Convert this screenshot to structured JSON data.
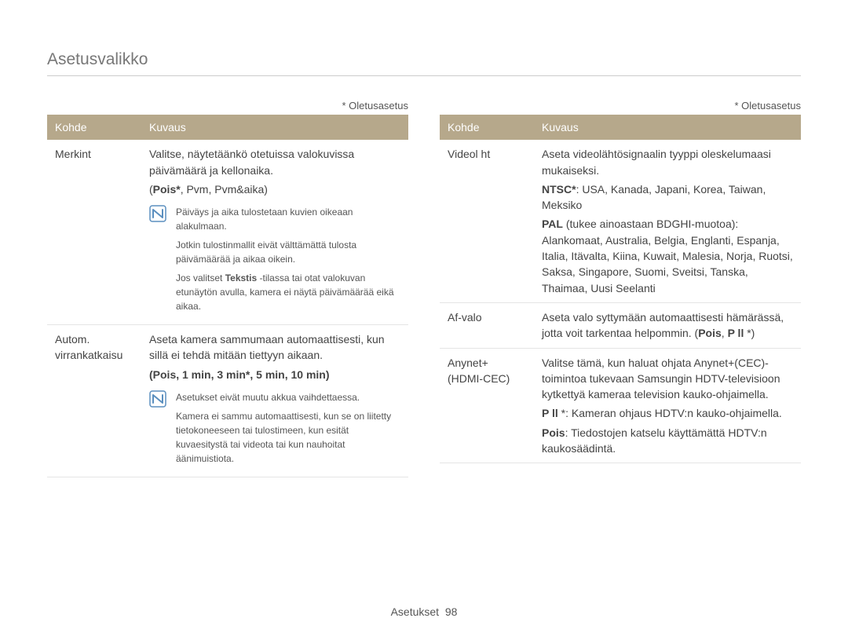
{
  "title": "Asetusvalikko",
  "default_label": "* Oletusasetus",
  "headers": {
    "kohde": "Kohde",
    "kuvaus": "Kuvaus"
  },
  "left": {
    "row1": {
      "kohde": "Merkint",
      "desc1": "Valitse, näytetäänkö otetuissa valokuvissa päivämäärä ja kellonaika.",
      "opts_prefix": "(",
      "opts_b": "Pois*",
      "opts_rest": ", Pvm, Pvm&aika)",
      "note1": "Päiväys ja aika tulostetaan kuvien oikeaan alakulmaan.",
      "note2": "Jotkin tulostinmallit eivät välttämättä tulosta päivämäärää ja aikaa oikein.",
      "note3_a": "Jos valitset ",
      "note3_b": "Tekstis",
      "note3_c": " -tilassa tai otat valokuvan etunäytön avulla, kamera ei näytä päivämäärää eikä aikaa."
    },
    "row2": {
      "kohde": "Autom. virrankatkaisu",
      "desc1": "Aseta kamera sammumaan automaattisesti, kun sillä ei tehdä mitään tiettyyn aikaan.",
      "opts": "(Pois, 1 min, 3 min*, 5 min, 10 min)",
      "note1": "Asetukset eivät muutu akkua vaihdettaessa.",
      "note2": "Kamera ei sammu automaattisesti, kun se on liitetty tietokoneeseen tai tulostimeen, kun esität kuvaesitystä tai videota tai kun nauhoitat äänimuistiota."
    }
  },
  "right": {
    "row1": {
      "kohde": "Videol ht",
      "desc1": "Aseta videolähtösignaalin tyyppi oleskelumaasi mukaiseksi.",
      "ntsc_b": "NTSC*",
      "ntsc_rest": ": USA, Kanada, Japani, Korea, Taiwan, Meksiko",
      "pal_b": "PAL",
      "pal_rest": " (tukee ainoastaan BDGHI-muotoa): Alankomaat, Australia, Belgia, Englanti, Espanja, Italia, Itävalta, Kiina, Kuwait, Malesia, Norja, Ruotsi, Saksa, Singapore, Suomi, Sveitsi, Tanska, Thaimaa, Uusi Seelanti"
    },
    "row2": {
      "kohde": "Af-valo",
      "desc_a": "Aseta valo syttymään automaattisesti hämärässä, jotta voit tarkentaa helpommin. (",
      "desc_b1": "Pois",
      "desc_mid": ", ",
      "desc_b2": "P ll",
      "desc_c": " *)"
    },
    "row3": {
      "kohde": "Anynet+ (HDMI-CEC)",
      "desc1": "Valitse tämä, kun haluat ohjata Anynet+(CEC)-toimintoa tukevaan Samsungin HDTV-televisioon kytkettyä kameraa television kauko-ohjaimella.",
      "pll_b": "P ll",
      "pll_rest": " *: Kameran ohjaus HDTV:n kauko-ohjaimella.",
      "pois_b": "Pois",
      "pois_rest": ": Tiedostojen katselu käyttämättä HDTV:n kaukosäädintä."
    }
  },
  "footer_section": "Asetukset",
  "footer_page": "98"
}
